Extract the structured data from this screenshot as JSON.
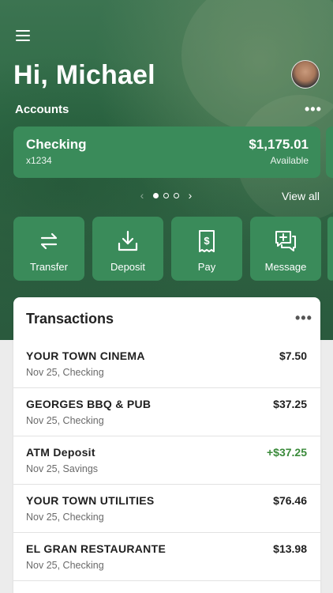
{
  "header": {
    "greeting": "Hi, Michael",
    "accounts_label": "Accounts",
    "more_glyph": "•••"
  },
  "account": {
    "name": "Checking",
    "number": "x1234",
    "balance": "$1,175.01",
    "balance_label": "Available"
  },
  "pager": {
    "prev_glyph": "‹",
    "next_glyph": "›",
    "view_all": "View all",
    "page_count": 3,
    "active_page": 1
  },
  "actions": [
    {
      "label": "Transfer",
      "icon": "transfer-icon"
    },
    {
      "label": "Deposit",
      "icon": "deposit-icon"
    },
    {
      "label": "Pay",
      "icon": "pay-icon"
    },
    {
      "label": "Message",
      "icon": "message-icon"
    }
  ],
  "transactions": {
    "title": "Transactions",
    "more_glyph": "•••",
    "items": [
      {
        "merchant": "YOUR TOWN CINEMA",
        "detail": "Nov 25, Checking",
        "amount": "$7.50",
        "credit": false
      },
      {
        "merchant": "GEORGES BBQ & PUB",
        "detail": "Nov 25, Checking",
        "amount": "$37.25",
        "credit": false
      },
      {
        "merchant": "ATM Deposit",
        "detail": "Nov 25, Savings",
        "amount": "+$37.25",
        "credit": true
      },
      {
        "merchant": "YOUR TOWN UTILITIES",
        "detail": "Nov 25, Checking",
        "amount": "$76.46",
        "credit": false
      },
      {
        "merchant": "EL GRAN RESTAURANTE",
        "detail": "Nov 25, Checking",
        "amount": "$13.98",
        "credit": false
      }
    ]
  },
  "colors": {
    "brand_green": "#3a8b5a",
    "hero_green": "#2f6a46",
    "credit_green": "#3a8a3a"
  }
}
